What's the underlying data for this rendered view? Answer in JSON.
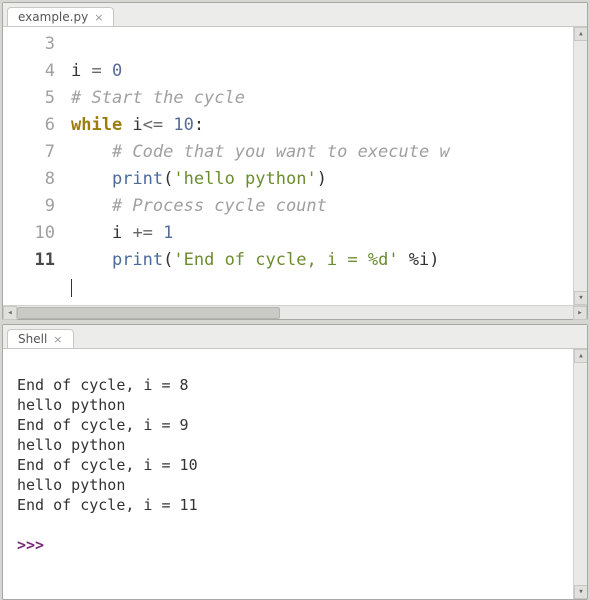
{
  "editor": {
    "tab_label": "example.py",
    "line_numbers": [
      "3",
      "4",
      "5",
      "6",
      "7",
      "8",
      "9",
      "10",
      "11"
    ],
    "current_line_index": 8,
    "code": {
      "l3": {
        "var": "i",
        "eq": " = ",
        "val": "0"
      },
      "l4": {
        "comment": "# Start the cycle"
      },
      "l5": {
        "kw": "while",
        "cond_var": " i",
        "cond_op": "<= ",
        "cond_val": "10",
        "colon": ":"
      },
      "l6": {
        "indent": "    ",
        "comment": "# Code that you want to execute w"
      },
      "l7": {
        "indent": "    ",
        "fn": "print",
        "open": "(",
        "str": "'hello python'",
        "close": ")"
      },
      "l8": {
        "indent": "    ",
        "comment": "# Process cycle count"
      },
      "l9": {
        "indent": "    ",
        "var": "i ",
        "op": "+= ",
        "val": "1"
      },
      "l10": {
        "indent": "    ",
        "fn": "print",
        "open": "(",
        "str": "'End of cycle, i = %d'",
        "rest": " %i)",
        "close": ""
      },
      "l11": {
        "text": ""
      }
    }
  },
  "shell": {
    "tab_label": "Shell",
    "output": [
      "End of cycle, i = 8",
      "hello python",
      "End of cycle, i = 9",
      "hello python",
      "End of cycle, i = 10",
      "hello python",
      "End of cycle, i = 11"
    ],
    "prompt": ">>> "
  }
}
